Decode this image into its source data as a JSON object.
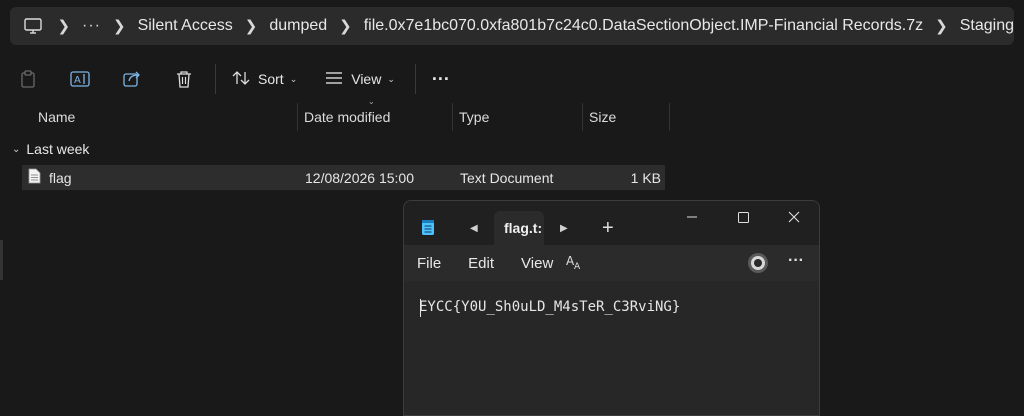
{
  "address_bar": {
    "computer_icon": "computer-icon",
    "more": "···",
    "crumbs": [
      "Silent Access",
      "dumped",
      "file.0x7e1bc070.0xfa801b7c24c0.DataSectionObject.IMP-Financial Records.7z",
      "Staging"
    ]
  },
  "toolbar": {
    "sort_label": "Sort",
    "view_label": "View",
    "more": "···"
  },
  "columns": {
    "name": "Name",
    "date": "Date modified",
    "type": "Type",
    "size": "Size"
  },
  "group": {
    "label": "Last week"
  },
  "files": [
    {
      "name": "flag",
      "date": "12/08/2026 15:00",
      "type": "Text Document",
      "size": "1 KB"
    }
  ],
  "notepad": {
    "tab_title": "flag.t:",
    "menu": {
      "file": "File",
      "edit": "Edit",
      "view": "View"
    },
    "content": "EYCC{Y0U_Sh0uLD_M4sTeR_C3RviNG}"
  }
}
